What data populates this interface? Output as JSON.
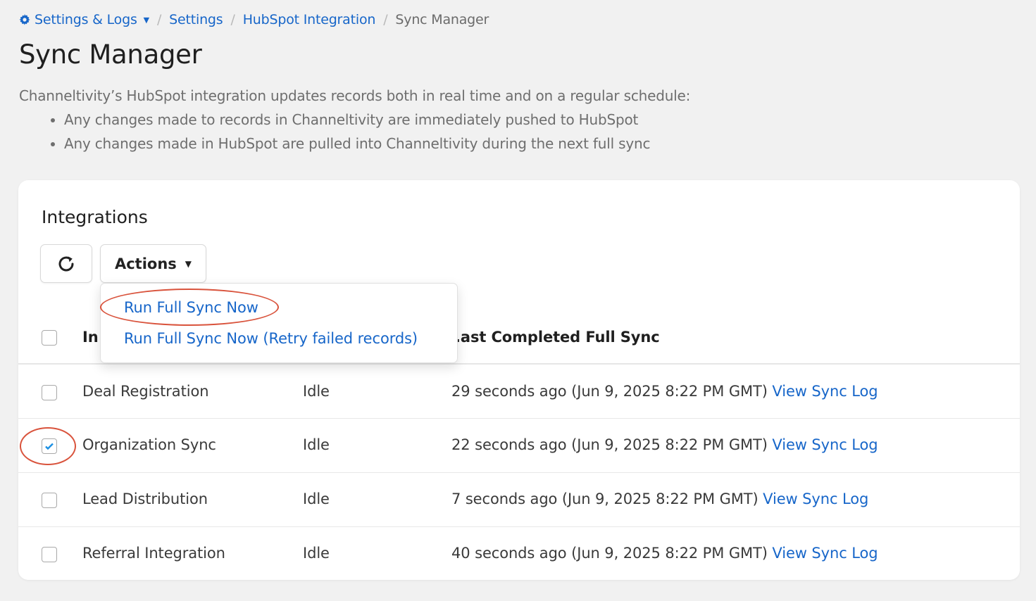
{
  "breadcrumb": {
    "items": [
      "Settings & Logs",
      "Settings",
      "HubSpot Integration"
    ],
    "current": "Sync Manager",
    "separator": "/"
  },
  "page": {
    "title": "Sync Manager",
    "intro": "Channeltivity’s HubSpot integration updates records both in real time and on a regular schedule:",
    "bullets": [
      "Any changes made to records in Channeltivity are immediately pushed to HubSpot",
      "Any changes made in HubSpot are pulled into Channeltivity during the next full sync"
    ]
  },
  "card": {
    "title": "Integrations",
    "actions_label": "Actions"
  },
  "table": {
    "header_integration": "In",
    "header_last_sync": ".ast Completed Full Sync",
    "view_log_label": "View Sync Log",
    "rows": [
      {
        "name": "Deal Registration",
        "status": "Idle",
        "last_sync": "29 seconds ago (Jun 9, 2025 8:22 PM GMT)",
        "checked": false
      },
      {
        "name": "Organization Sync",
        "status": "Idle",
        "last_sync": "22 seconds ago (Jun 9, 2025 8:22 PM GMT)",
        "checked": true
      },
      {
        "name": "Lead Distribution",
        "status": "Idle",
        "last_sync": "7 seconds ago (Jun 9, 2025 8:22 PM GMT)",
        "checked": false
      },
      {
        "name": "Referral Integration",
        "status": "Idle",
        "last_sync": "40 seconds ago (Jun 9, 2025 8:22 PM GMT)",
        "checked": false
      }
    ]
  },
  "dropdown": {
    "items": [
      "Run Full Sync Now",
      "Run Full Sync Now (Retry failed records)"
    ]
  },
  "icons": {
    "settings": "gear-icon",
    "refresh": "refresh-icon",
    "caret": "caret-down-icon",
    "check": "checkmark-icon"
  },
  "colors": {
    "link": "#1766c9",
    "annotation": "#d9533c",
    "checkbox_checked": "#1a8fe3"
  }
}
